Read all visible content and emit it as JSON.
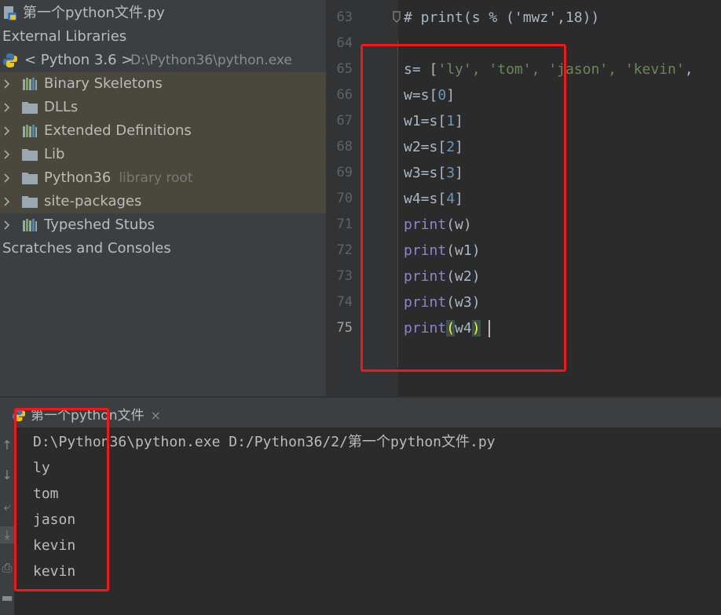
{
  "project_tree": {
    "file_item": "第一个python文件.py",
    "external_libraries": "External Libraries",
    "sdk": {
      "name": "< Python 3.6 >",
      "path": "D:\\Python36\\python.exe"
    },
    "children": [
      {
        "label": "Binary Skeletons",
        "icon": "library-icon",
        "hint": ""
      },
      {
        "label": "DLLs",
        "icon": "folder-icon",
        "hint": ""
      },
      {
        "label": "Extended Definitions",
        "icon": "library-icon",
        "hint": ""
      },
      {
        "label": "Lib",
        "icon": "folder-icon",
        "hint": ""
      },
      {
        "label": "Python36",
        "icon": "folder-icon",
        "hint": "library root"
      },
      {
        "label": "site-packages",
        "icon": "folder-icon",
        "hint": ""
      },
      {
        "label": "Typeshed Stubs",
        "icon": "library-icon",
        "hint": ""
      }
    ],
    "scratches": "Scratches and Consoles"
  },
  "editor": {
    "line_numbers": [
      "63",
      "64",
      "65",
      "66",
      "67",
      "68",
      "69",
      "70",
      "71",
      "72",
      "73",
      "74",
      "75"
    ],
    "current_line": "75",
    "lines": {
      "l63": "# print(s % ('mwz',18))",
      "l65": {
        "a": "s= [",
        "s1": "'ly'",
        "c1": ", ",
        "s2": "'tom'",
        "c2": ", ",
        "s3": "'jason'",
        "c3": ", ",
        "s4": "'kevin'",
        "c4": ","
      },
      "l66": {
        "a": "w=s[",
        "n": "0",
        "b": "]"
      },
      "l67": {
        "a": "w1=s[",
        "n": "1",
        "b": "]"
      },
      "l68": {
        "a": "w2=s[",
        "n": "2",
        "b": "]"
      },
      "l69": {
        "a": "w3=s[",
        "n": "3",
        "b": "]"
      },
      "l70": {
        "a": "w4=s[",
        "n": "4",
        "b": "]"
      },
      "l71": {
        "fn": "print",
        "args": "(w)"
      },
      "l72": {
        "fn": "print",
        "args": "(w1)"
      },
      "l73": {
        "fn": "print",
        "args": "(w2)"
      },
      "l74": {
        "fn": "print",
        "args": "(w3)"
      },
      "l75": {
        "fn": "print",
        "open": "(",
        "arg": "w4",
        "close": ")"
      }
    }
  },
  "run_panel": {
    "tab_label": "第一个python文件",
    "close_glyph": "×",
    "output": [
      "D:\\Python36\\python.exe D:/Python36/2/第一个python文件.py",
      "ly",
      "tom",
      "jason",
      "kevin",
      "kevin"
    ]
  },
  "colors": {
    "annotation": "#f01919",
    "string": "#6a8759",
    "number": "#6897bb",
    "builtin": "#8888c6"
  }
}
